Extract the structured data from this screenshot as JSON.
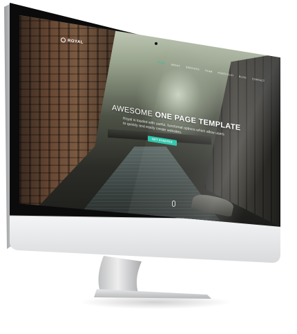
{
  "site": {
    "logo_text": "ROYAL",
    "nav": [
      {
        "label": "HOME",
        "active": true
      },
      {
        "label": "ABOUT",
        "active": false
      },
      {
        "label": "SERVICES",
        "active": false
      },
      {
        "label": "TEAM",
        "active": false
      },
      {
        "label": "PORTFOLIO",
        "active": false
      },
      {
        "label": "BLOG",
        "active": false
      },
      {
        "label": "CONTACT",
        "active": false
      }
    ],
    "hero": {
      "title_light": "AWESOME",
      "title_strong": "ONE PAGE TEMPLATE",
      "subtitle": "Royal is loaded with useful, functional options which allow users to quickly and easily create websites.",
      "cta_label": "GET STARTED"
    }
  },
  "colors": {
    "accent": "#27c5a8",
    "bezel": "#0b0b0c",
    "chin": "#e9eaeb",
    "stand": "#d8d9da"
  },
  "icons": {
    "logo": "crown-circle-icon",
    "scroll": "mouse-scroll-icon"
  }
}
